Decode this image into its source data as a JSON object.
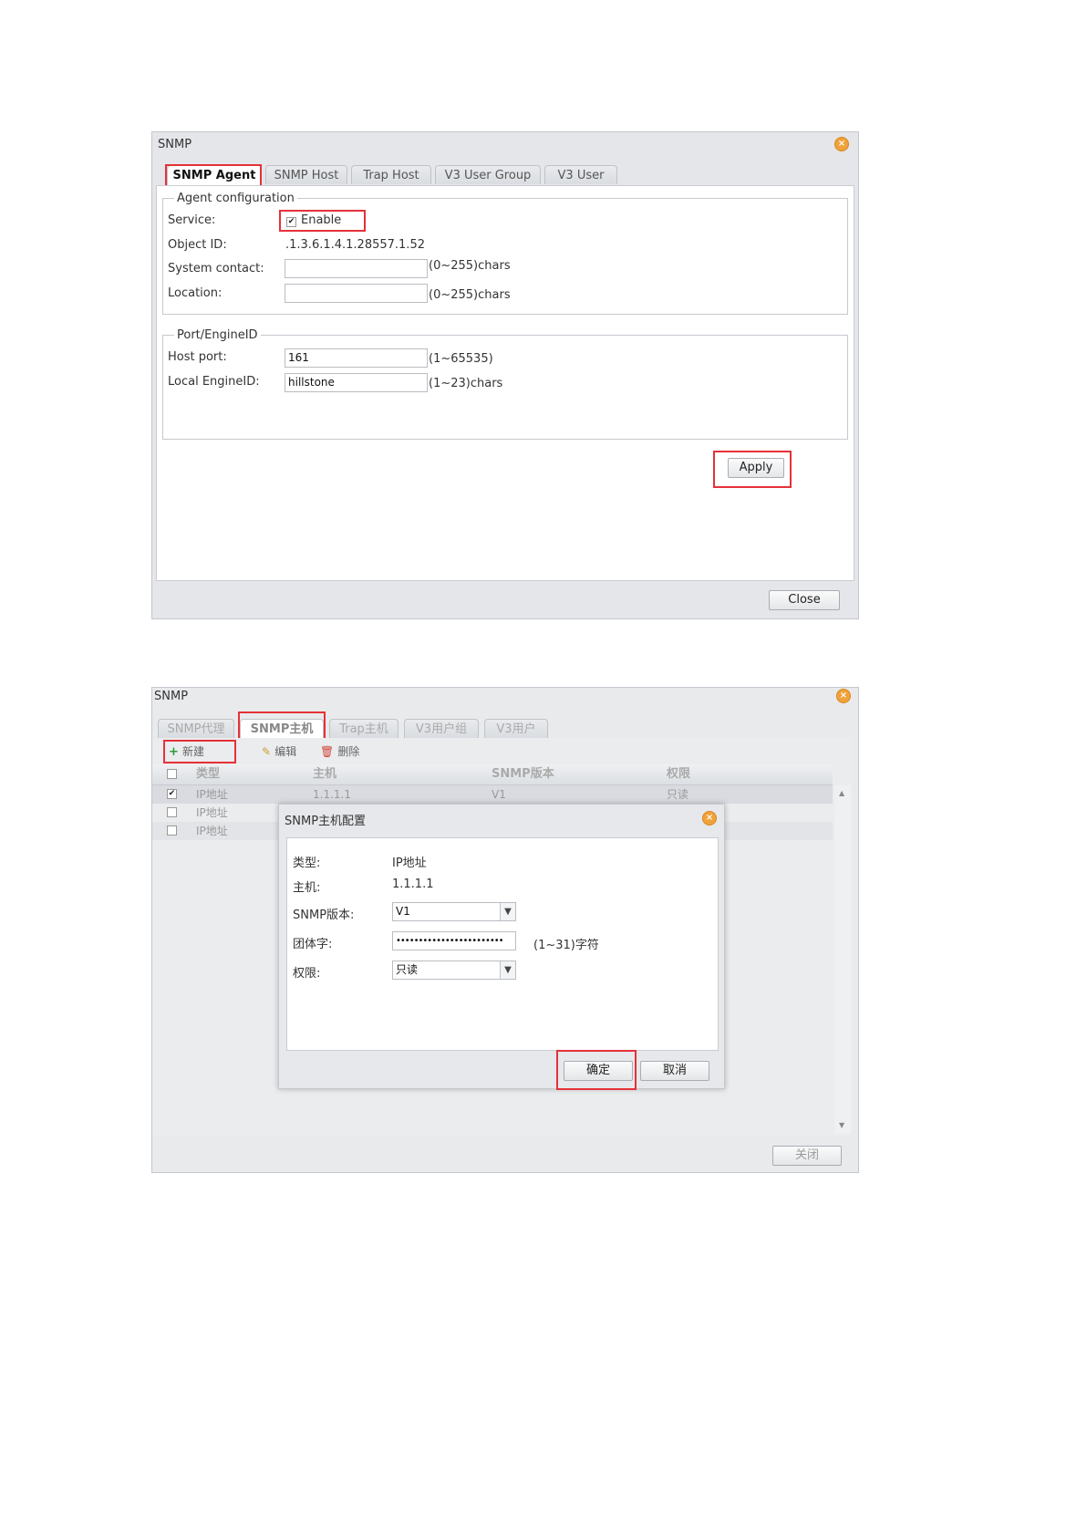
{
  "dialog1": {
    "title": "SNMP",
    "tabs": [
      "SNMP Agent",
      "SNMP Host",
      "Trap Host",
      "V3 User Group",
      "V3 User"
    ],
    "agent_section": {
      "legend": "Agent configuration",
      "service_label": "Service:",
      "service_option": "Enable",
      "service_checked": true,
      "object_id_label": "Object ID:",
      "object_id_value": ".1.3.6.1.4.1.28557.1.52",
      "contact_label": "System contact:",
      "contact_value": "",
      "contact_hint": "(0~255)chars",
      "location_label": "Location:",
      "location_value": "",
      "location_hint": "(0~255)chars"
    },
    "port_section": {
      "legend": "Port/EngineID",
      "host_port_label": "Host port:",
      "host_port_value": "161",
      "host_port_hint": "(1~65535)",
      "engine_label": "Local EngineID:",
      "engine_value": "hillstone",
      "engine_hint": "(1~23)chars"
    },
    "apply_label": "Apply",
    "close_label": "Close"
  },
  "dialog2": {
    "title": "SNMP",
    "tabs": [
      "SNMP代理",
      "SNMP主机",
      "Trap主机",
      "V3用户组",
      "V3用户"
    ],
    "toolbar": {
      "new_label": "新建",
      "edit_label": "编辑",
      "delete_label": "删除"
    },
    "columns": [
      "类型",
      "主机",
      "SNMP版本",
      "权限"
    ],
    "rows": [
      {
        "type": "IP地址",
        "host": "1.1.1.1",
        "version": "V1",
        "permission": "只读",
        "checked": true
      },
      {
        "type": "IP地址",
        "host": "",
        "version": "",
        "permission": "",
        "checked": false
      },
      {
        "type": "IP地址",
        "host": "",
        "version": "",
        "permission": "",
        "checked": false
      }
    ],
    "close_label": "关闭"
  },
  "host_config": {
    "title": "SNMP主机配置",
    "type_label": "类型:",
    "type_value": "IP地址",
    "host_label": "主机:",
    "host_value": "1.1.1.1",
    "version_label": "SNMP版本:",
    "version_value": "V1",
    "community_label": "团体字:",
    "community_value": "••••••••••••••••••••••••",
    "community_hint": "(1~31)字符",
    "permission_label": "权限:",
    "permission_value": "只读",
    "ok_label": "确定",
    "cancel_label": "取消"
  },
  "colors": {
    "highlight": "#e53138",
    "close_icon": "#f0a23a"
  }
}
